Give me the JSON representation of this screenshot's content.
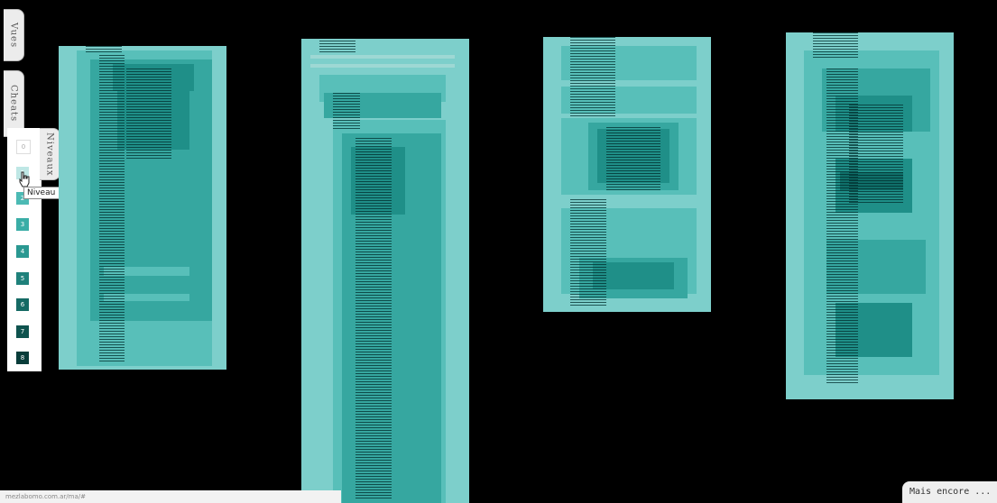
{
  "tabs": {
    "views_label": "Vues",
    "cheats_label": "Cheats",
    "levels_label": "Niveaux"
  },
  "levels": [
    {
      "label": "0",
      "color": "#ffffff"
    },
    {
      "label": "1",
      "color": "#bfe7e5"
    },
    {
      "label": "2",
      "color": "#4cbab4"
    },
    {
      "label": "3",
      "color": "#3aada6"
    },
    {
      "label": "4",
      "color": "#2a9891"
    },
    {
      "label": "5",
      "color": "#1f817b"
    },
    {
      "label": "6",
      "color": "#156a64"
    },
    {
      "label": "7",
      "color": "#0e534e"
    },
    {
      "label": "8",
      "color": "#093d3a"
    }
  ],
  "tooltip": "Niveau 1",
  "status_url": "mezlabomo.com.ar/ma/#",
  "more_label": "Mais encore ...",
  "colors": {
    "background": "#000000",
    "level1": "#7dcfcb",
    "level2": "#58bfb9",
    "level3": "#36a7a0",
    "level4": "#1f8f88",
    "level5": "#0f6f69"
  }
}
